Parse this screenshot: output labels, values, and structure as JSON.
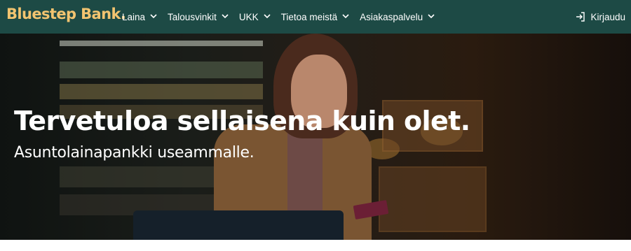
{
  "brand": {
    "name": "Bluestep Bank."
  },
  "nav": {
    "items": [
      {
        "label": "Laina"
      },
      {
        "label": "Talousvinkit"
      },
      {
        "label": "UKK"
      },
      {
        "label": "Tietoa meistä"
      },
      {
        "label": "Asiakaspalvelu"
      }
    ],
    "login_label": "Kirjaudu"
  },
  "hero": {
    "title": "Tervetuloa sellaisena kuin olet.",
    "subtitle": "Asuntolainapankki useammalle."
  },
  "colors": {
    "nav_background": "#1d4a45",
    "brand_accent": "#f2c470",
    "text_light": "#ffffff"
  },
  "icons": [
    "chevron-down-icon",
    "login-icon"
  ]
}
